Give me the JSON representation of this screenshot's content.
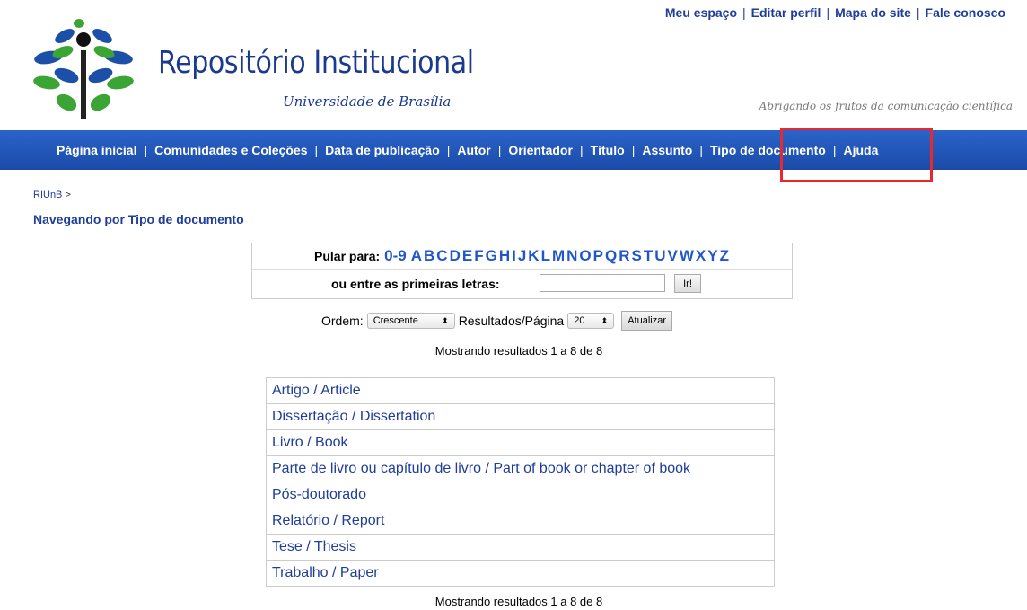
{
  "top_links": [
    "Meu espaço",
    "Editar perfil",
    "Mapa do site",
    "Fale conosco"
  ],
  "brand": {
    "title": "Repositório Institucional",
    "subtitle": "Universidade de Brasília",
    "tagline": "Abrigando os frutos da comunicação científica"
  },
  "nav": {
    "items": [
      "Página inicial",
      "Comunidades e Coleções",
      "Data de publicação",
      "Autor",
      "Orientador",
      "Título",
      "Assunto",
      "Tipo de documento",
      "Ajuda"
    ],
    "highlighted": "Tipo de documento"
  },
  "breadcrumb": {
    "root": "RIUnB",
    "separator": ">"
  },
  "page_title": "Navegando por Tipo de documento",
  "jump": {
    "label": "Pular para:",
    "letters": [
      "0-9",
      "A",
      "B",
      "C",
      "D",
      "E",
      "F",
      "G",
      "H",
      "I",
      "J",
      "K",
      "L",
      "M",
      "N",
      "O",
      "P",
      "Q",
      "R",
      "S",
      "T",
      "U",
      "V",
      "W",
      "X",
      "Y",
      "Z"
    ],
    "first_letters_label": "ou entre as primeiras letras:",
    "input_value": "",
    "go_label": "Ir!"
  },
  "sort": {
    "order_label": "Ordem:",
    "order_value": "Crescente",
    "results_label": "Resultados/Página",
    "results_value": "20",
    "update_label": "Atualizar"
  },
  "showing_text": "Mostrando resultados 1 a 8 de 8",
  "results": [
    "Artigo / Article",
    "Dissertação / Dissertation",
    "Livro / Book",
    "Parte de livro ou capítulo de livro / Part of book or chapter of book",
    "Pós-doutorado",
    "Relatório / Report",
    "Tese / Thesis",
    "Trabalho / Paper"
  ],
  "colors": {
    "link": "#1f3d99",
    "nav_bg": "#1a4ba8",
    "highlight_box": "#e8292b"
  }
}
